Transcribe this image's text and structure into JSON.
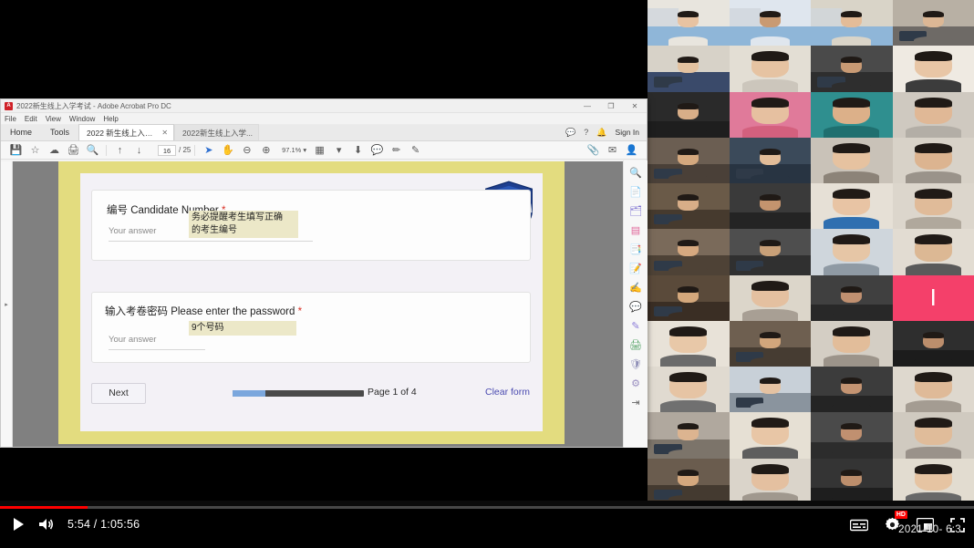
{
  "window": {
    "app": "Adobe Acrobat Pro DC",
    "title": "2022新生线上入学考试 - Adobe Acrobat Pro DC",
    "logo_text": "A",
    "controls": {
      "minimize": "—",
      "maximize": "❐",
      "close": "✕"
    },
    "menu": [
      "File",
      "Edit",
      "View",
      "Window",
      "Help"
    ]
  },
  "tabstrip": {
    "home": "Home",
    "tools": "Tools",
    "documents": [
      {
        "label": "2022 新生线上入学...",
        "close": "✕",
        "active": true
      },
      {
        "label": "2022新生线上入学...",
        "close": "",
        "active": false
      }
    ],
    "right_icons": [
      {
        "name": "comment-icon",
        "glyph": "💬"
      },
      {
        "name": "help-icon",
        "glyph": "?"
      },
      {
        "name": "bell-icon",
        "glyph": "🔔"
      }
    ],
    "sign_in": "Sign In"
  },
  "toolbar": {
    "left_tools": [
      {
        "name": "save-icon",
        "glyph": "💾"
      },
      {
        "name": "star-icon",
        "glyph": "☆"
      },
      {
        "name": "upload-cloud-icon",
        "glyph": "☁"
      },
      {
        "name": "print-icon",
        "glyph": "🖨"
      },
      {
        "name": "search-icon",
        "glyph": "🔍"
      }
    ],
    "page_prev": "↑",
    "page_next": "↓",
    "page_current": "16",
    "page_total": "/ 25",
    "nav_tools": [
      {
        "name": "select-cursor-icon",
        "glyph": "➤",
        "selected": true
      },
      {
        "name": "hand-tool-icon",
        "glyph": "✋"
      },
      {
        "name": "zoom-out-icon",
        "glyph": "⊖"
      },
      {
        "name": "zoom-in-icon",
        "glyph": "⊕"
      }
    ],
    "zoom_value": "97.1%",
    "zoom_caret": "▾",
    "after_zoom_tools": [
      {
        "name": "fit-page-icon",
        "glyph": "▦"
      },
      {
        "name": "fit-width-caret-icon",
        "glyph": "▾"
      },
      {
        "name": "read-mode-icon",
        "glyph": "⬇"
      },
      {
        "name": "comment-tool-icon",
        "glyph": "💬"
      },
      {
        "name": "highlight-tool-icon",
        "glyph": "✏"
      },
      {
        "name": "draw-tool-icon",
        "glyph": "✎"
      }
    ],
    "right_tools": [
      {
        "name": "attach-cloud-icon",
        "glyph": "📎"
      },
      {
        "name": "email-icon",
        "glyph": "✉"
      },
      {
        "name": "add-person-icon",
        "glyph": "👤"
      }
    ]
  },
  "right_rail": [
    {
      "name": "search-tool-icon",
      "glyph": "🔍",
      "color": "#666666"
    },
    {
      "name": "create-pdf-icon",
      "glyph": "📄",
      "color": "#e8768c"
    },
    {
      "name": "combine-files-icon",
      "glyph": "🗂",
      "color": "#7b6fd0"
    },
    {
      "name": "organize-pages-icon",
      "glyph": "▤",
      "color": "#e0669a"
    },
    {
      "name": "export-pdf-icon",
      "glyph": "📑",
      "color": "#2f9e8f"
    },
    {
      "name": "edit-pdf-icon",
      "glyph": "📝",
      "color": "#4fa05f"
    },
    {
      "name": "fill-sign-icon",
      "glyph": "✍",
      "color": "#d8b23a"
    },
    {
      "name": "comment-rail-icon",
      "glyph": "💬",
      "color": "#e8a33d"
    },
    {
      "name": "stamp-icon",
      "glyph": "✎",
      "color": "#8a7bd8"
    },
    {
      "name": "print-production-icon",
      "glyph": "🖨",
      "color": "#4a9e5c"
    },
    {
      "name": "protect-icon",
      "glyph": "🛡",
      "color": "#9090b8"
    },
    {
      "name": "more-tools-icon",
      "glyph": "⚙",
      "color": "#9a8fc0"
    },
    {
      "name": "collapse-panel-icon",
      "glyph": "⇥",
      "color": "#666666"
    }
  ],
  "left_rail": {
    "expand_icon": "▸"
  },
  "scrollbar": {
    "up": "▲",
    "down": "▼"
  },
  "form": {
    "questions": [
      {
        "title_cn": "编号",
        "title_en": "Candidate Number",
        "required": "*",
        "answer_placeholder": "Your answer",
        "annotation": "务必提醒考生填写正确\n的考生编号"
      },
      {
        "title_cn": "输入考卷密码",
        "title_en": "Please enter the password",
        "required": "*",
        "answer_placeholder": "Your answer",
        "annotation": "9个号码"
      }
    ],
    "next_button": "Next",
    "page_label": "Page 1 of 4",
    "clear_form": "Clear form",
    "progress_percent": 25,
    "logo_alt": "school-crest"
  },
  "player": {
    "play_glyph": "▶",
    "volume_glyph": "🔊",
    "time_display": "5:54 / 1:05:56",
    "current_time": "5:54",
    "duration": "1:05:56",
    "progress_percent": 9,
    "controls_right": [
      {
        "name": "subtitles-icon",
        "glyph": "⌸"
      },
      {
        "name": "settings-gear-icon",
        "glyph": "⚙",
        "badge": "HD"
      },
      {
        "name": "miniplayer-icon",
        "glyph": "❐"
      },
      {
        "name": "fullscreen-icon",
        "glyph": "⛶"
      }
    ],
    "timestamp_overlay": "2021-10-   6:3"
  },
  "meeting": {
    "avatar_tile": {
      "letter": "I",
      "color": "#f4406a"
    },
    "tiles": [
      {
        "bg": "#8fb6d8",
        "sk": "#e8c3a2",
        "sh": "#e8e5de",
        "type": "class"
      },
      {
        "bg": "#8fb6d8",
        "sk": "#c99a72",
        "sh": "#dfe6ee",
        "type": "class"
      },
      {
        "bg": "#8fb6d8",
        "sk": "#e4bc98",
        "sh": "#d9d4c8",
        "type": "class"
      },
      {
        "bg": "#b8b0a4",
        "sk": "#dcb795",
        "sh": "#6e6a66",
        "type": "room"
      },
      {
        "bg": "#d7d2c8",
        "sk": "#e3c2a0",
        "sh": "#3a4a6a",
        "type": "desk"
      },
      {
        "bg": "#e3ded4",
        "sk": "#e6c3a2",
        "sh": "#ccc6bc",
        "type": "face"
      },
      {
        "bg": "#4a4a4a",
        "sk": "#c89a74",
        "sh": "#2e2e2e",
        "type": "desk"
      },
      {
        "bg": "#efeae2",
        "sk": "#e8c6a6",
        "sh": "#3c3c3c",
        "type": "face"
      },
      {
        "bg": "#2a2a2a",
        "sk": "#d8ae88",
        "sh": "#1e1e1e",
        "type": "dark"
      },
      {
        "bg": "#e07a9a",
        "sk": "#e6c0a0",
        "sh": "#d4607e",
        "type": "face"
      },
      {
        "bg": "#2f8f8f",
        "sk": "#dcb089",
        "sh": "#1f6f6f",
        "type": "face"
      },
      {
        "bg": "#cfc9c0",
        "sk": "#e0b896",
        "sh": "#b3aea6",
        "type": "face"
      },
      {
        "bg": "#6b5e52",
        "sk": "#d4a87e",
        "sh": "#4a4038",
        "type": "room"
      },
      {
        "bg": "#3b4a5a",
        "sk": "#e2bc98",
        "sh": "#283442",
        "type": "desk"
      },
      {
        "bg": "#c9c2b8",
        "sk": "#e6c2a0",
        "sh": "#8c8378",
        "type": "face"
      },
      {
        "bg": "#d8d2c8",
        "sk": "#dcb490",
        "sh": "#9a938a",
        "type": "face"
      },
      {
        "bg": "#6a5a48",
        "sk": "#d8ae88",
        "sh": "#463a2e",
        "type": "desk"
      },
      {
        "bg": "#3a3a3a",
        "sk": "#c4946e",
        "sh": "#242424",
        "type": "dark"
      },
      {
        "bg": "#e6e0d6",
        "sk": "#e8c4a4",
        "sh": "#2f6fb0",
        "type": "face"
      },
      {
        "bg": "#dcd6cc",
        "sk": "#e0bb99",
        "sh": "#b0a89c",
        "type": "face"
      },
      {
        "bg": "#7a6a5a",
        "sk": "#d6a980",
        "sh": "#4e4236",
        "type": "room"
      },
      {
        "bg": "#4e4e4e",
        "sk": "#c8a078",
        "sh": "#303030",
        "type": "desk"
      },
      {
        "bg": "#cfd6dc",
        "sk": "#e6c6a6",
        "sh": "#8f9aa4",
        "type": "face"
      },
      {
        "bg": "#e2dcd2",
        "sk": "#dcb894",
        "sh": "#5a5a5a",
        "type": "face"
      },
      {
        "bg": "#5a4a3a",
        "sk": "#d4a87c",
        "sh": "#3a2e24",
        "type": "desk"
      },
      {
        "bg": "#dcd6ca",
        "sk": "#e4c0a0",
        "sh": "#a89f94",
        "type": "face"
      },
      {
        "bg": "#404040",
        "sk": "#c09070",
        "sh": "#282828",
        "type": "dark"
      },
      {
        "bg": "#e8e2d8",
        "sk": "#e8c8a8",
        "sh": "#6a6a6a",
        "type": "face"
      },
      {
        "bg": "#6e5f50",
        "sk": "#d2a67c",
        "sh": "#463c32",
        "type": "room"
      },
      {
        "bg": "#d4cec4",
        "sk": "#e2bd9a",
        "sh": "#9c948a",
        "type": "face"
      },
      {
        "bg": "#2e2e2e",
        "sk": "#bc8e6c",
        "sh": "#1c1c1c",
        "type": "dark"
      },
      {
        "bg": "#e0dad0",
        "sk": "#e6c4a4",
        "sh": "#707070",
        "type": "face"
      },
      {
        "bg": "#c8d0d8",
        "sk": "#e4c2a2",
        "sh": "#8a949e",
        "type": "desk"
      },
      {
        "bg": "#3c3c3c",
        "sk": "#c49472",
        "sh": "#242424",
        "type": "dark"
      },
      {
        "bg": "#ded8ce",
        "sk": "#dfba98",
        "sh": "#a49c92",
        "type": "face"
      },
      {
        "bg": "#b0a89e",
        "sk": "#dcb490",
        "sh": "#7c746a",
        "type": "room"
      },
      {
        "bg": "#e6e0d4",
        "sk": "#e8c6a6",
        "sh": "#5e5e5e",
        "type": "face"
      },
      {
        "bg": "#4a4a4a",
        "sk": "#c09070",
        "sh": "#2c2c2c",
        "type": "dark"
      },
      {
        "bg": "#d0cac0",
        "sk": "#e0bc9a",
        "sh": "#9a928a",
        "type": "face"
      },
      {
        "bg": "#6a5c4e",
        "sk": "#d4a87e",
        "sh": "#443a30",
        "type": "room"
      },
      {
        "bg": "#dad4ca",
        "sk": "#e4c0a0",
        "sh": "#a0988e",
        "type": "face"
      },
      {
        "bg": "#343434",
        "sk": "#bc8e6c",
        "sh": "#1e1e1e",
        "type": "dark"
      },
      {
        "bg": "#e2dcd0",
        "sk": "#e6c4a2",
        "sh": "#686868",
        "type": "face"
      },
      {
        "bg": "#c4bcb2",
        "sk": "#ddb692",
        "sh": "#8e867c",
        "type": "room"
      }
    ]
  }
}
